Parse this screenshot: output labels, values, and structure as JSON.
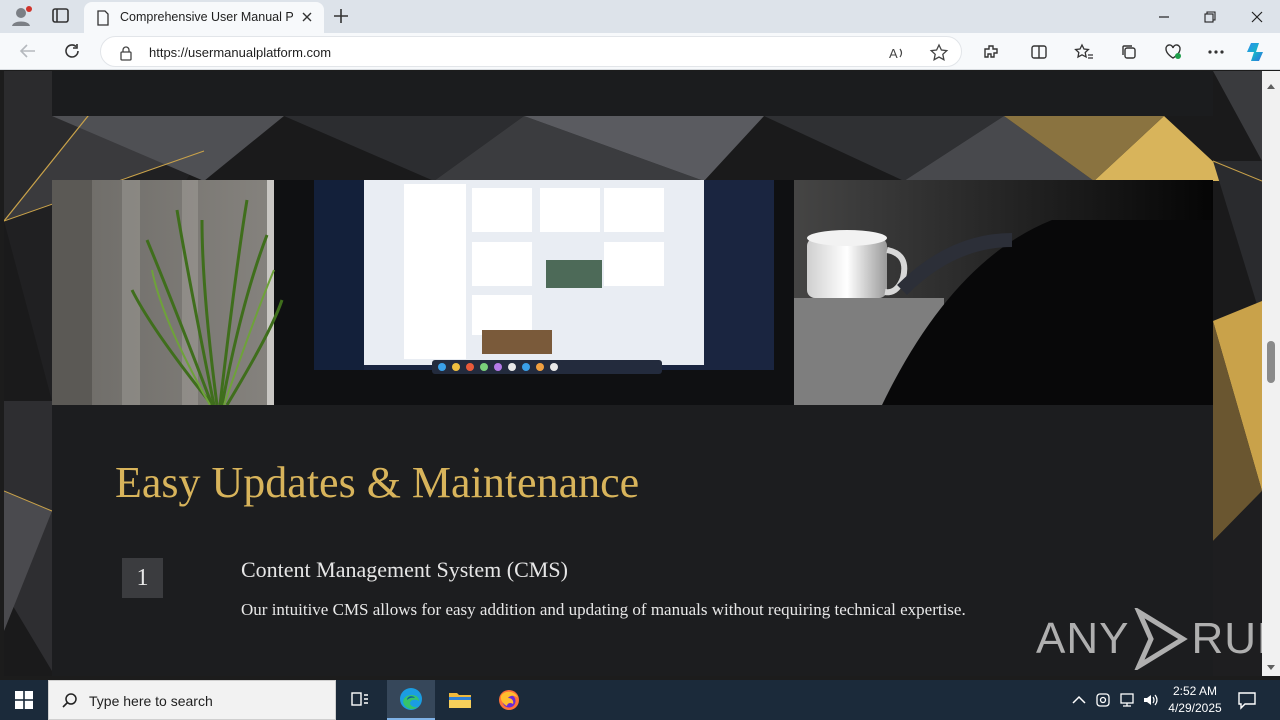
{
  "browser": {
    "tab_title": "Comprehensive User Manual Platform",
    "url_scheme": "https://",
    "url_host": "usermanualplatform.com"
  },
  "page": {
    "section_heading": "Easy Updates & Maintenance",
    "feature": {
      "number": "1",
      "title": "Content Management System (CMS)",
      "description": "Our intuitive CMS allows for easy addition and updating of manuals without requiring technical expertise."
    },
    "colors": {
      "heading_gold": "#d8b45b",
      "card_bg": "#1c1d1f"
    }
  },
  "watermark": {
    "left": "ANY",
    "right": "RUN"
  },
  "taskbar": {
    "search_placeholder": "Type here to search",
    "time": "2:52 AM",
    "date": "4/29/2025",
    "icons": [
      "windows-start-icon",
      "task-view-icon",
      "edge-icon",
      "file-explorer-icon",
      "firefox-icon"
    ]
  }
}
